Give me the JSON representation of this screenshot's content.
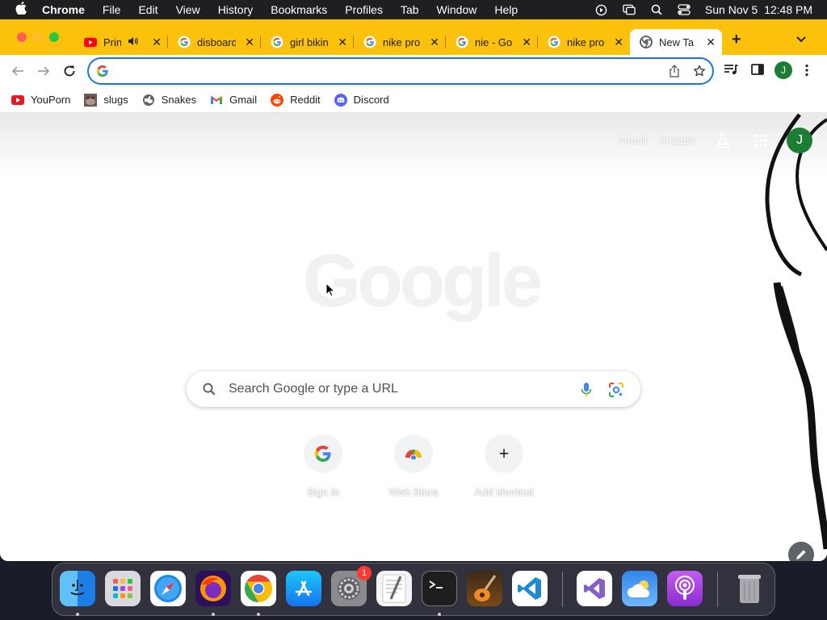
{
  "menubar": {
    "app_name": "Chrome",
    "items": [
      "File",
      "Edit",
      "View",
      "History",
      "Bookmarks",
      "Profiles",
      "Tab",
      "Window",
      "Help"
    ],
    "clock": "Sun Nov 5  12:48 PM"
  },
  "tabs": [
    {
      "title": "Prin",
      "icon": "youtube-icon",
      "audio": true
    },
    {
      "title": "disboard",
      "icon": "google-icon"
    },
    {
      "title": "girl biking",
      "icon": "google-icon"
    },
    {
      "title": "nike pro",
      "icon": "google-icon"
    },
    {
      "title": "nie - Go",
      "icon": "google-icon"
    },
    {
      "title": "nike pro",
      "icon": "google-icon"
    },
    {
      "title": "New Tab",
      "icon": "chrome-icon",
      "active": true
    }
  ],
  "toolbar": {
    "profile_initial": "J",
    "address_value": ""
  },
  "bookmarks": [
    {
      "label": "YouPorn",
      "icon": "youporn-icon"
    },
    {
      "label": "slugs",
      "icon": "slug-icon"
    },
    {
      "label": "Snakes",
      "icon": "globe-icon"
    },
    {
      "label": "Gmail",
      "icon": "gmail-icon"
    },
    {
      "label": "Reddit",
      "icon": "reddit-icon"
    },
    {
      "label": "Discord",
      "icon": "discord-icon"
    }
  ],
  "ntp": {
    "links": {
      "gmail": "Gmail",
      "images": "Images"
    },
    "avatar_initial": "J",
    "logo_text": "Google",
    "search_placeholder": "Search Google or type a URL",
    "shortcuts": [
      {
        "label": "Sign in",
        "icon": "google-icon"
      },
      {
        "label": "Web Store",
        "icon": "web-store-icon"
      },
      {
        "label": "Add shortcut",
        "icon": "plus-icon"
      }
    ]
  },
  "dock": {
    "apps": [
      "Finder",
      "Launchpad",
      "Safari",
      "Firefox",
      "Chrome",
      "App Store",
      "System Settings",
      "TextEdit",
      "Terminal",
      "GarageBand",
      "Visual Studio Code",
      "Visual Studio",
      "Weather",
      "Podcasts",
      "Trash"
    ],
    "settings_badge": "1"
  },
  "colors": {
    "tabstrip": "#fbc10b",
    "accent": "#1a73e8",
    "avatar": "#1e7d34"
  }
}
